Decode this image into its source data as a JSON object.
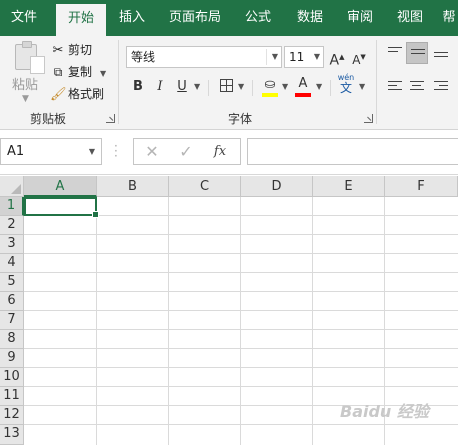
{
  "ribbon_tabs": [
    {
      "label": "文件",
      "active": false
    },
    {
      "label": "开始",
      "active": true
    },
    {
      "label": "插入",
      "active": false
    },
    {
      "label": "页面布局",
      "active": false
    },
    {
      "label": "公式",
      "active": false
    },
    {
      "label": "数据",
      "active": false
    },
    {
      "label": "审阅",
      "active": false
    },
    {
      "label": "视图",
      "active": false
    },
    {
      "label": "帮",
      "active": false
    }
  ],
  "clipboard_group": {
    "label": "剪贴板",
    "paste_label": "粘贴",
    "cut_label": "剪切",
    "copy_label": "复制",
    "format_painter_label": "格式刷"
  },
  "font_group": {
    "label": "字体",
    "font_name": "等线",
    "font_size": "11",
    "bold": "B",
    "italic": "I",
    "underline": "U",
    "grow_font": "A",
    "shrink_font": "A",
    "font_color_letter": "A",
    "phonetic_top": "wén",
    "phonetic_bottom": "文",
    "fill_color": "#ffff00",
    "font_color": "#ff0000"
  },
  "formula_bar": {
    "name_box": "A1",
    "cancel_symbol": "✕",
    "enter_symbol": "✓",
    "fx_symbol": "fx",
    "formula": ""
  },
  "sheet": {
    "columns": [
      "A",
      "B",
      "C",
      "D",
      "E",
      "F"
    ],
    "rows": [
      "1",
      "2",
      "3",
      "4",
      "5",
      "6",
      "7",
      "8",
      "9",
      "10",
      "11",
      "12",
      "13"
    ],
    "selected_cell": "A1"
  },
  "accent_color": "#217346",
  "watermark": "Baidu 经验"
}
